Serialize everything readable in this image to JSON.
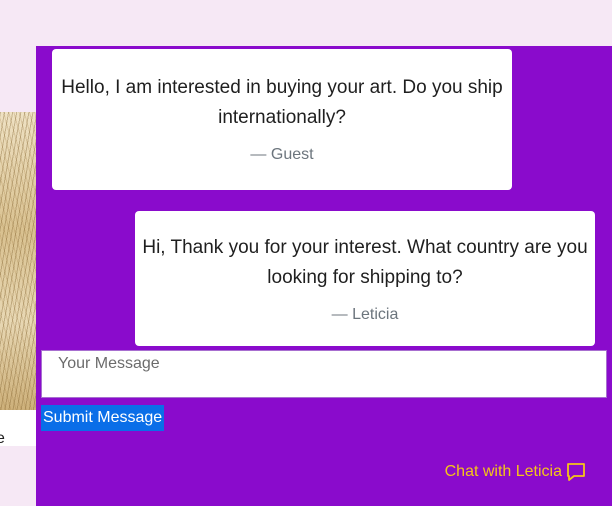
{
  "background": {
    "partial_text": "e"
  },
  "chat": {
    "messages": [
      {
        "text": "Hello, I am interested in buying your art. Do you ship internationally?",
        "author": "— Guest"
      },
      {
        "text": "Hi, Thank you for your interest. What country are you looking for shipping to?",
        "author": "— Leticia"
      }
    ],
    "input_placeholder": "Your Message",
    "submit_label": "Submit Message",
    "chat_with_label": "Chat with Leticia",
    "chat_icon": "speech-bubble-icon"
  },
  "colors": {
    "panel": "#8a0bcc",
    "page_background": "#f6e8f5",
    "submit_button": "#0a6ee8",
    "chat_link": "#f5c518"
  }
}
